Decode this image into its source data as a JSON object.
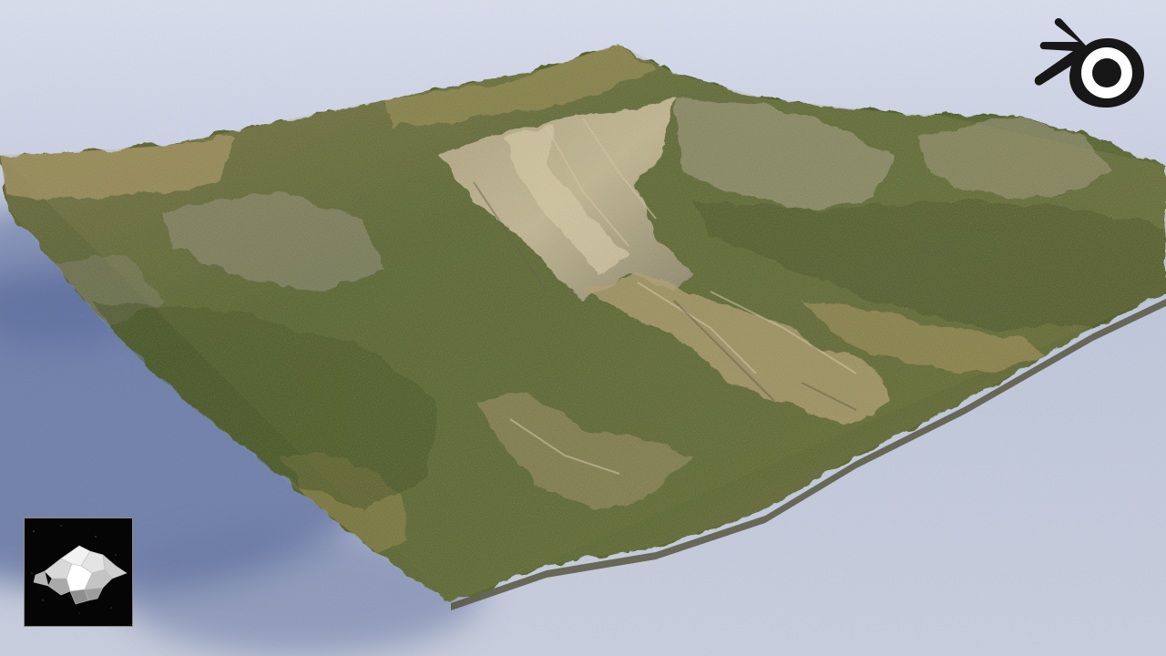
{
  "scene": {
    "subject": "3d-terrain-render",
    "colors": {
      "sky_top": "#d6dcea",
      "sky_mid": "#b7c1d7",
      "ground_light": "#c9cfe0",
      "ground_shadow": "#5d6f9a",
      "grass_dark": "#3f4f22",
      "grass_mid": "#5b6a2c",
      "grass_lit": "#8d8a3e",
      "rock_lit": "#d2c3a0",
      "rock_mid": "#a89b82",
      "rock_shadow": "#6f6c5c"
    }
  },
  "overlays": {
    "logo_icon": "blender-logo-icon",
    "logo_color": "#1a1a1a",
    "thumbnail_icon": "lowpoly-rock-icon",
    "thumbnail_bg": "#050505"
  }
}
